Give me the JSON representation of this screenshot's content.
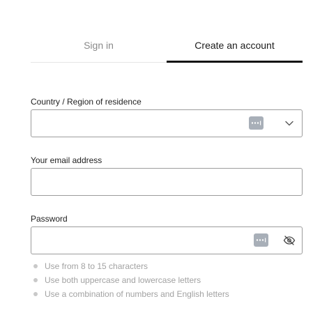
{
  "tabs": {
    "sign_in": "Sign in",
    "create_account": "Create an account"
  },
  "fields": {
    "country": {
      "label": "Country / Region of residence",
      "value": ""
    },
    "email": {
      "label": "Your email address",
      "value": ""
    },
    "password": {
      "label": "Password",
      "value": ""
    }
  },
  "password_requirements": [
    "Use from 8 to 15 characters",
    "Use both uppercase and lowercase letters",
    "Use a combination of numbers and English letters"
  ],
  "icons": {
    "password_manager": "password-manager-icon",
    "dropdown": "chevron-down-icon",
    "visibility": "eye-off-icon"
  },
  "colors": {
    "active_tab_underline": "#121212",
    "input_border": "#9c9c9c",
    "hint_text": "#a2a2a2",
    "badge": "#a8afb8"
  }
}
